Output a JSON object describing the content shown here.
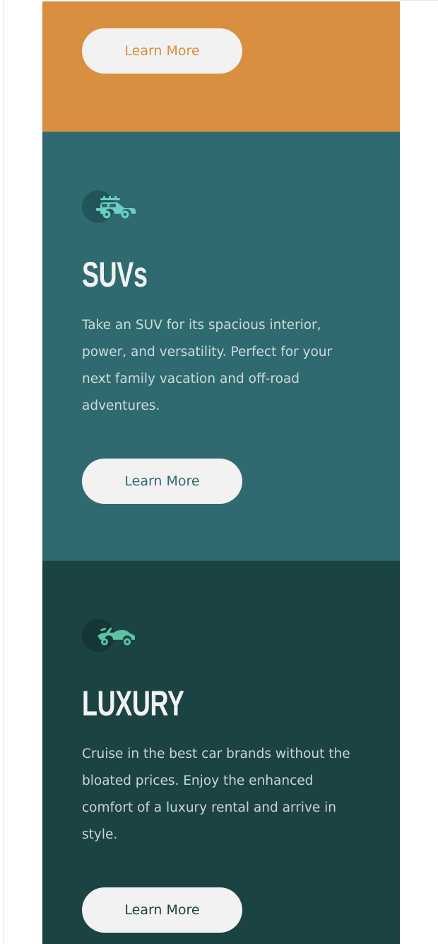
{
  "colors": {
    "sedans_bg": "#d88f3f",
    "suvs_bg": "#2e6a70",
    "luxury_bg": "#1b4344",
    "button_bg": "#f2f2f2",
    "heading_text": "#f2f2f2"
  },
  "cards": [
    {
      "id": "sedans",
      "button_label": "Learn More"
    },
    {
      "id": "suvs",
      "icon": "suv-car-icon",
      "title": "SUVs",
      "text": "Take an SUV for its spacious interior, power, and versatility. Perfect for your next family vacation and off-road adventures.",
      "button_label": "Learn More"
    },
    {
      "id": "luxury",
      "icon": "luxury-car-icon",
      "title": "LUXURY",
      "text": "Cruise in the best car brands without the bloated prices. Enjoy the enhanced comfort of a luxury rental and arrive in style.",
      "button_label": "Learn More"
    }
  ]
}
